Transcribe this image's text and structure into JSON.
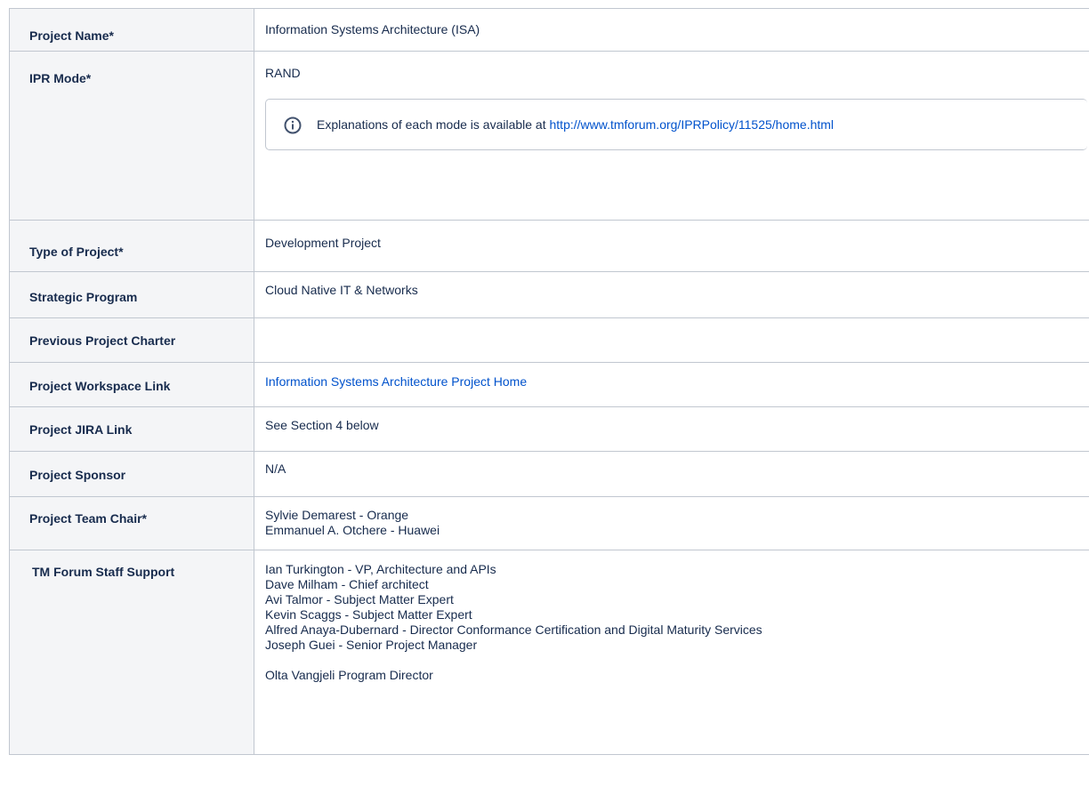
{
  "rows": [
    {
      "key": "Project Name*",
      "value": "Information Systems Architecture (ISA)"
    },
    {
      "key": "IPR Mode*",
      "value": "RAND"
    },
    {
      "key": "Type of Project*",
      "value": "Development Project"
    },
    {
      "key": "Strategic Program",
      "value": "Cloud Native IT & Networks"
    },
    {
      "key": "Previous Project Charter",
      "value": ""
    },
    {
      "key": "Project Workspace Link",
      "value": "Information Systems Architecture Project Home"
    },
    {
      "key": "Project JIRA Link",
      "value": "See Section 4 below"
    },
    {
      "key": "Project Sponsor",
      "value": "N/A"
    },
    {
      "key": "Project Team Chair*",
      "values": [
        "Sylvie Demarest - Orange",
        "Emmanuel A. Otchere - Huawei"
      ]
    },
    {
      "key": "TM Forum Staff Support",
      "values": [
        "Ian Turkington - VP, Architecture and APIs",
        "Dave Milham - Chief architect",
        "Avi Talmor - Subject Matter Expert",
        "Kevin Scaggs - Subject Matter Expert",
        "Alfred Anaya-Dubernard - Director Conformance Certification and Digital Maturity Services",
        "Joseph Guei  - Senior Project Manager",
        "Olta Vangjeli Program Director"
      ]
    }
  ],
  "info_panel": {
    "text": "Explanations of each mode is available at ",
    "link": "http://www.tmforum.org/IPRPolicy/11525/home.html",
    "icon": "info-icon"
  },
  "colors": {
    "header_bg": "#f4f5f7",
    "border": "#c1c7d0",
    "link": "#0052cc",
    "text": "#172b4d"
  }
}
